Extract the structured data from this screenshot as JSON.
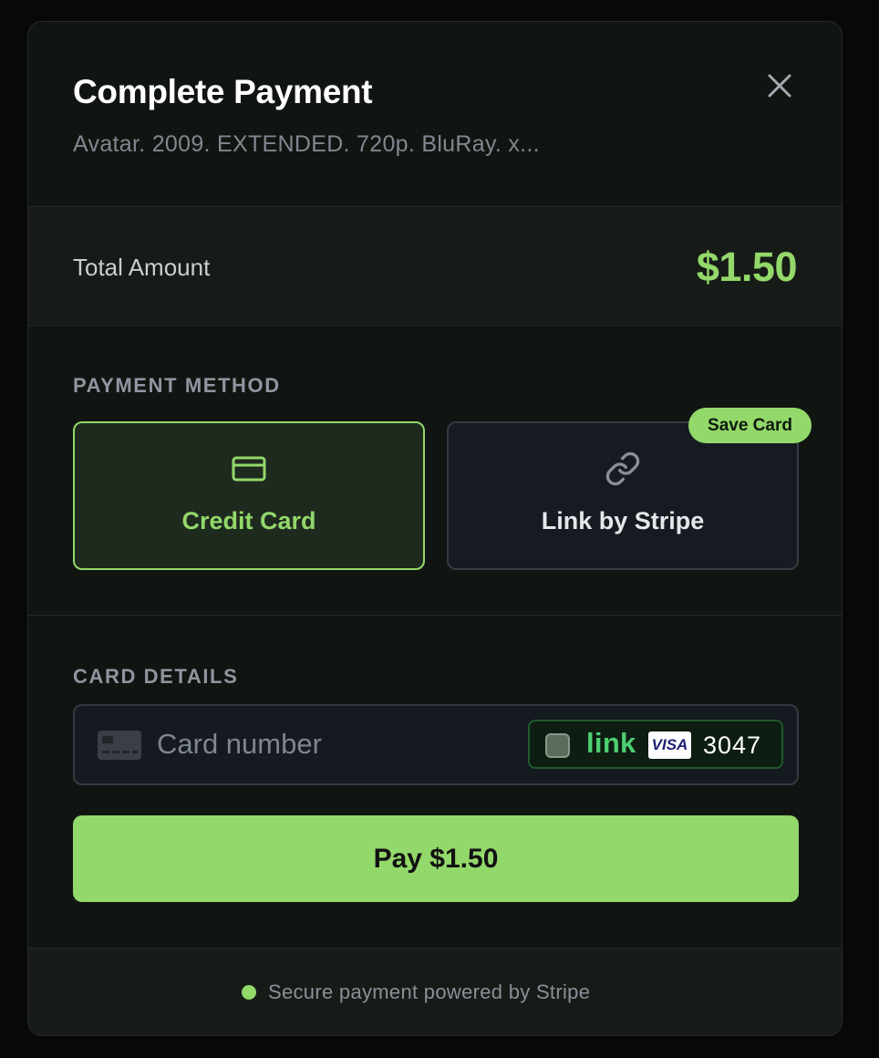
{
  "modal": {
    "title": "Complete Payment",
    "subtitle": "Avatar. 2009. EXTENDED. 720p. BluRay. x...",
    "close_icon": "close-icon"
  },
  "total": {
    "label": "Total Amount",
    "amount": "$1.50"
  },
  "payment_method": {
    "section_label": "PAYMENT METHOD",
    "options": [
      {
        "label": "Credit Card",
        "icon": "credit-card-icon",
        "selected": true
      },
      {
        "label": "Link by Stripe",
        "icon": "link-icon",
        "selected": false
      }
    ],
    "badge": "Save Card"
  },
  "card_details": {
    "section_label": "CARD DETAILS",
    "placeholder": "Card number",
    "link_chip": {
      "brand": "link",
      "card_brand": "VISA",
      "last4": "3047"
    }
  },
  "pay_button": {
    "label": "Pay $1.50"
  },
  "footer": {
    "secure_text": "Secure payment powered by Stripe"
  },
  "colors": {
    "accent": "#93d86a",
    "background": "#111512",
    "link_green": "#4ccf72"
  }
}
